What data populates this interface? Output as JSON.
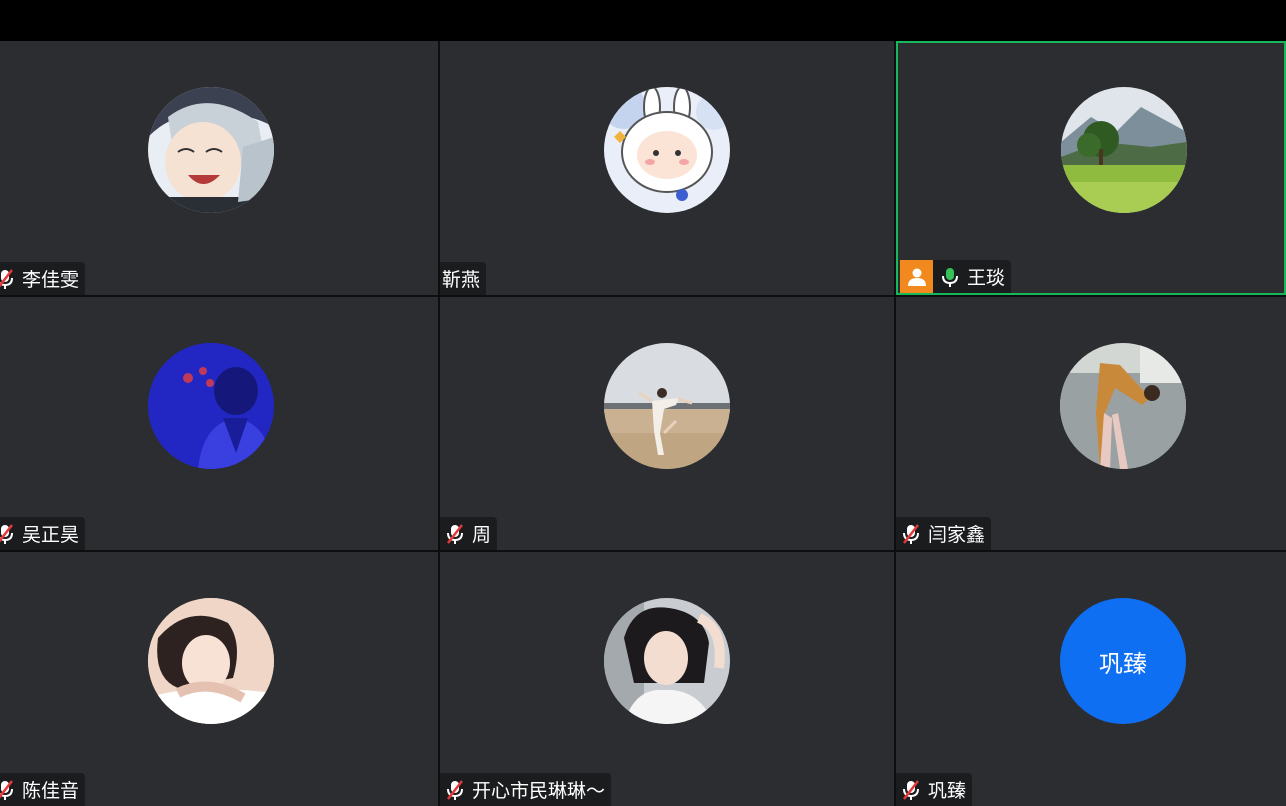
{
  "colors": {
    "tile_bg": "#2b2d31",
    "active_border": "#16b85a",
    "host_badge": "#f2891f",
    "text_avatar_bg": "#0f6ff2",
    "mic_on": "#36c15a"
  },
  "participants": [
    {
      "name": "李佳雯",
      "mic": "muted",
      "avatar": "anime-character-photo"
    },
    {
      "name": "靳燕",
      "mic": "none",
      "avatar": "cartoon-bunny-photo"
    },
    {
      "name": "王琰",
      "mic": "on",
      "avatar": "landscape-tree-photo",
      "host": true,
      "speaking": true
    },
    {
      "name": "吴正昊",
      "mic": "muted",
      "avatar": "blue-portrait-photo"
    },
    {
      "name": "周",
      "mic": "muted",
      "avatar": "dancer-field-photo"
    },
    {
      "name": "闫家鑫",
      "mic": "muted",
      "avatar": "stretching-person-photo"
    },
    {
      "name": "陈佳音",
      "mic": "muted",
      "avatar": "portrait-photo"
    },
    {
      "name": "开心市民琳琳～",
      "mic": "muted",
      "avatar": "portrait-photo"
    },
    {
      "name": "巩臻",
      "mic": "muted",
      "avatar": "text-avatar",
      "avatar_text": "巩臻"
    }
  ]
}
